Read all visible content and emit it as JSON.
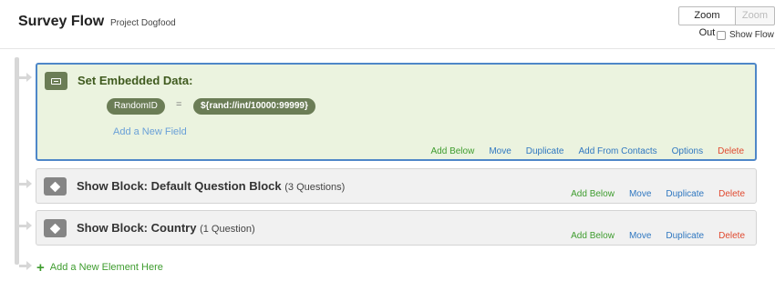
{
  "header": {
    "title": "Survey Flow",
    "project": "Project Dogfood",
    "zoom_out_label": "Zoom Out",
    "zoom_in_label": "Zoom",
    "show_flow_label": "Show Flow"
  },
  "embedded_block": {
    "title": "Set Embedded Data:",
    "field_key": "RandomID",
    "equals": "=",
    "field_value": "${rand://int/10000:99999}",
    "add_field_label": "Add a New Field",
    "actions": {
      "add_below": "Add Below",
      "move": "Move",
      "duplicate": "Duplicate",
      "add_from_contacts": "Add From Contacts",
      "options": "Options",
      "delete": "Delete"
    }
  },
  "show_blocks": [
    {
      "title": "Show Block: Default Question Block",
      "count": "(3 Questions)",
      "actions": {
        "add_below": "Add Below",
        "move": "Move",
        "duplicate": "Duplicate",
        "delete": "Delete"
      }
    },
    {
      "title": "Show Block: Country",
      "count": "(1 Question)",
      "actions": {
        "add_below": "Add Below",
        "move": "Move",
        "duplicate": "Duplicate",
        "delete": "Delete"
      }
    }
  ],
  "add_element_label": "Add a New Element Here",
  "colors": {
    "accent_green": "#3e9c2e",
    "link_blue": "#2f77c0",
    "delete_red": "#e0492f",
    "selected_border": "#4e87c8",
    "embedded_bg": "#ebf3df"
  }
}
